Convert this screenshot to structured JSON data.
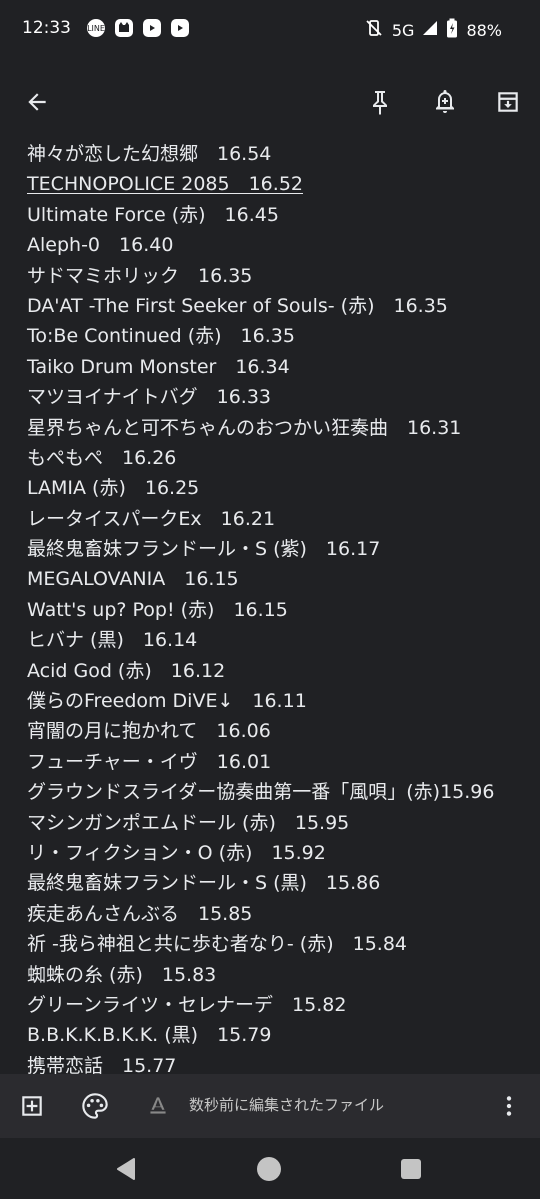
{
  "status_bar": {
    "time": "12:33",
    "notification_icons": [
      "line-icon",
      "cat-icon",
      "youtube-icon",
      "youtube-icon"
    ],
    "network": "5G",
    "battery": "88%"
  },
  "toolbar": {
    "back_icon": "arrow-back-icon",
    "pin_icon": "pin-icon",
    "reminder_icon": "add-reminder-icon",
    "archive_icon": "archive-icon"
  },
  "note": {
    "lines": [
      "神々が恋した幻想郷　16.54",
      "TECHNOPOLICE 2085　16.52",
      "Ultimate Force (赤)　16.45",
      "Aleph-0　16.40",
      "サドマミホリック　16.35",
      "DA'AT -The First Seeker of Souls- (赤)　16.35",
      "To:Be Continued (赤)　16.35",
      "Taiko Drum Monster　16.34",
      "マツヨイナイトバグ　16.33",
      "星界ちゃんと可不ちゃんのおつかい狂奏曲　16.31",
      "もぺもぺ　16.26",
      "LAMIA (赤)　16.25",
      "レータイスパークEx　16.21",
      "最終鬼畜妹フランドール・S (紫)　16.17",
      "MEGALOVANIA　16.15",
      "Watt's up? Pop! (赤)　16.15",
      "ヒバナ (黒)　16.14",
      "Acid God (赤)　16.12",
      "僕らのFreedom DiVE↓　16.11",
      "宵闇の月に抱かれて　16.06",
      "フューチャー・イヴ　16.01",
      "グラウンドスライダー協奏曲第一番「風唄」(赤)15.96",
      "マシンガンポエムドール (赤)　15.95",
      "リ・フィクション・O (赤)　15.92",
      "最終鬼畜妹フランドール・S (黒)　15.86",
      "疾走あんさんぶる　15.85",
      "祈 -我ら神祖と共に歩む者なり- (赤)　15.84",
      "蜘蛛の糸 (赤)　15.83",
      "グリーンライツ・セレナーデ　15.82",
      "B.B.K.K.B.K.K. (黒)　15.79",
      "携帯恋話　15.77"
    ]
  },
  "bottom_bar": {
    "status_text": "数秒前に編集されたファイル",
    "icons": [
      "add-box-icon",
      "palette-icon",
      "text-format-icon",
      "more-vert-icon"
    ]
  },
  "nav_bar": {
    "icons": [
      "nav-back-icon",
      "nav-home-icon",
      "nav-recents-icon"
    ]
  },
  "colors": {
    "background": "#202124",
    "text": "#e8eaed",
    "bottom_bar": "#2b2b2f"
  }
}
